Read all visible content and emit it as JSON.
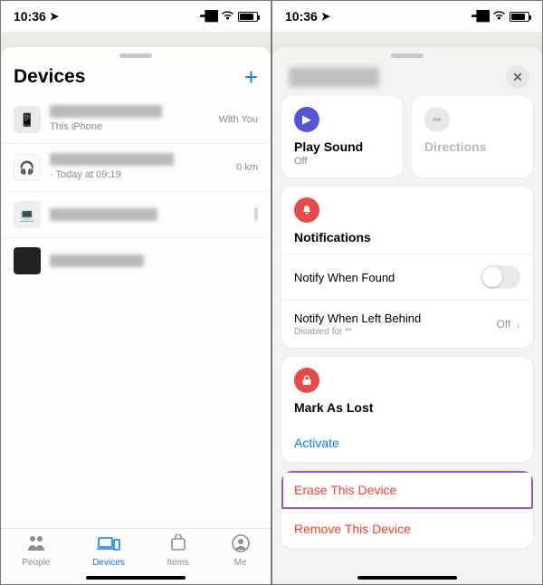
{
  "status": {
    "time": "10:36",
    "loc_glyph": "➤"
  },
  "left": {
    "title": "Devices",
    "add_glyph": "+",
    "rows": [
      {
        "sub": "This iPhone",
        "trailing": "With You"
      },
      {
        "sub": " · Today at 09:19",
        "trailing": "0 km"
      },
      {
        "sub": "",
        "trailing": ""
      },
      {
        "sub": "",
        "trailing": ""
      }
    ],
    "tabs": {
      "people": "People",
      "devices": "Devices",
      "items": "Items",
      "me": "Me"
    }
  },
  "right": {
    "close_glyph": "✕",
    "play_sound": {
      "title": "Play Sound",
      "sub": "Off"
    },
    "directions": {
      "title": "Directions"
    },
    "notifications": {
      "header": "Notifications",
      "notify_found": "Notify When Found",
      "left_behind": {
        "title": "Notify When Left Behind",
        "sub": "Disabled for **",
        "value": "Off"
      }
    },
    "mark_lost": {
      "header": "Mark As Lost",
      "activate": "Activate"
    },
    "erase": "Erase This Device",
    "remove": "Remove This Device"
  }
}
